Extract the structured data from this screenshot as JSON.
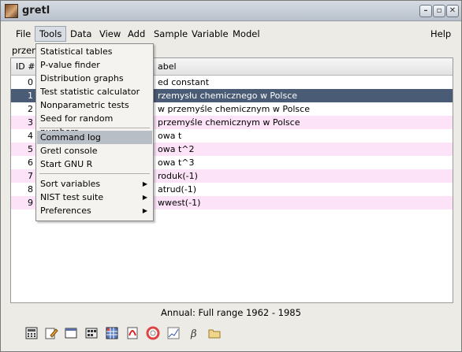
{
  "window": {
    "title": "gretl"
  },
  "menubar": {
    "items": [
      "File",
      "Tools",
      "Data",
      "View",
      "Add",
      "Sample",
      "Variable",
      "Model"
    ],
    "help": "Help"
  },
  "list_title_prefix": "przem",
  "list": {
    "header_id": "ID #",
    "header_label": "abel",
    "rows": [
      {
        "id": "0",
        "label": "ed constant"
      },
      {
        "id": "1",
        "label": "rzemysłu chemicznego w Polsce"
      },
      {
        "id": "2",
        "label": "w przemyśle chemicznym w Polsce"
      },
      {
        "id": "3",
        "label": "przemyśle chemicznym w Polsce"
      },
      {
        "id": "4",
        "label": "owa t"
      },
      {
        "id": "5",
        "label": "owa t^2"
      },
      {
        "id": "6",
        "label": "owa t^3"
      },
      {
        "id": "7",
        "label": "roduk(-1)"
      },
      {
        "id": "8",
        "label": "atrud(-1)"
      },
      {
        "id": "9",
        "label": "wwest(-1)"
      }
    ]
  },
  "tools_menu": {
    "items": [
      "Statistical tables",
      "P-value finder",
      "Distribution graphs",
      "Test statistic calculator",
      "Nonparametric tests",
      "Seed for random numbers",
      "Command log",
      "Gretl console",
      "Start GNU R",
      "Sort variables",
      "NIST test suite",
      "Preferences"
    ]
  },
  "status": "Annual: Full range 1962 - 1985",
  "toolbar_icons": [
    "calculator-icon",
    "edit-icon",
    "terminal-icon",
    "session-icon",
    "matrix-icon",
    "pdf-icon",
    "help-icon",
    "plot-icon",
    "beta-icon",
    "folder-icon"
  ],
  "colors": {
    "selected_row": "#4a5b75",
    "alt_row": "#fde3f7",
    "menu_highlight": "#b8bec6"
  }
}
